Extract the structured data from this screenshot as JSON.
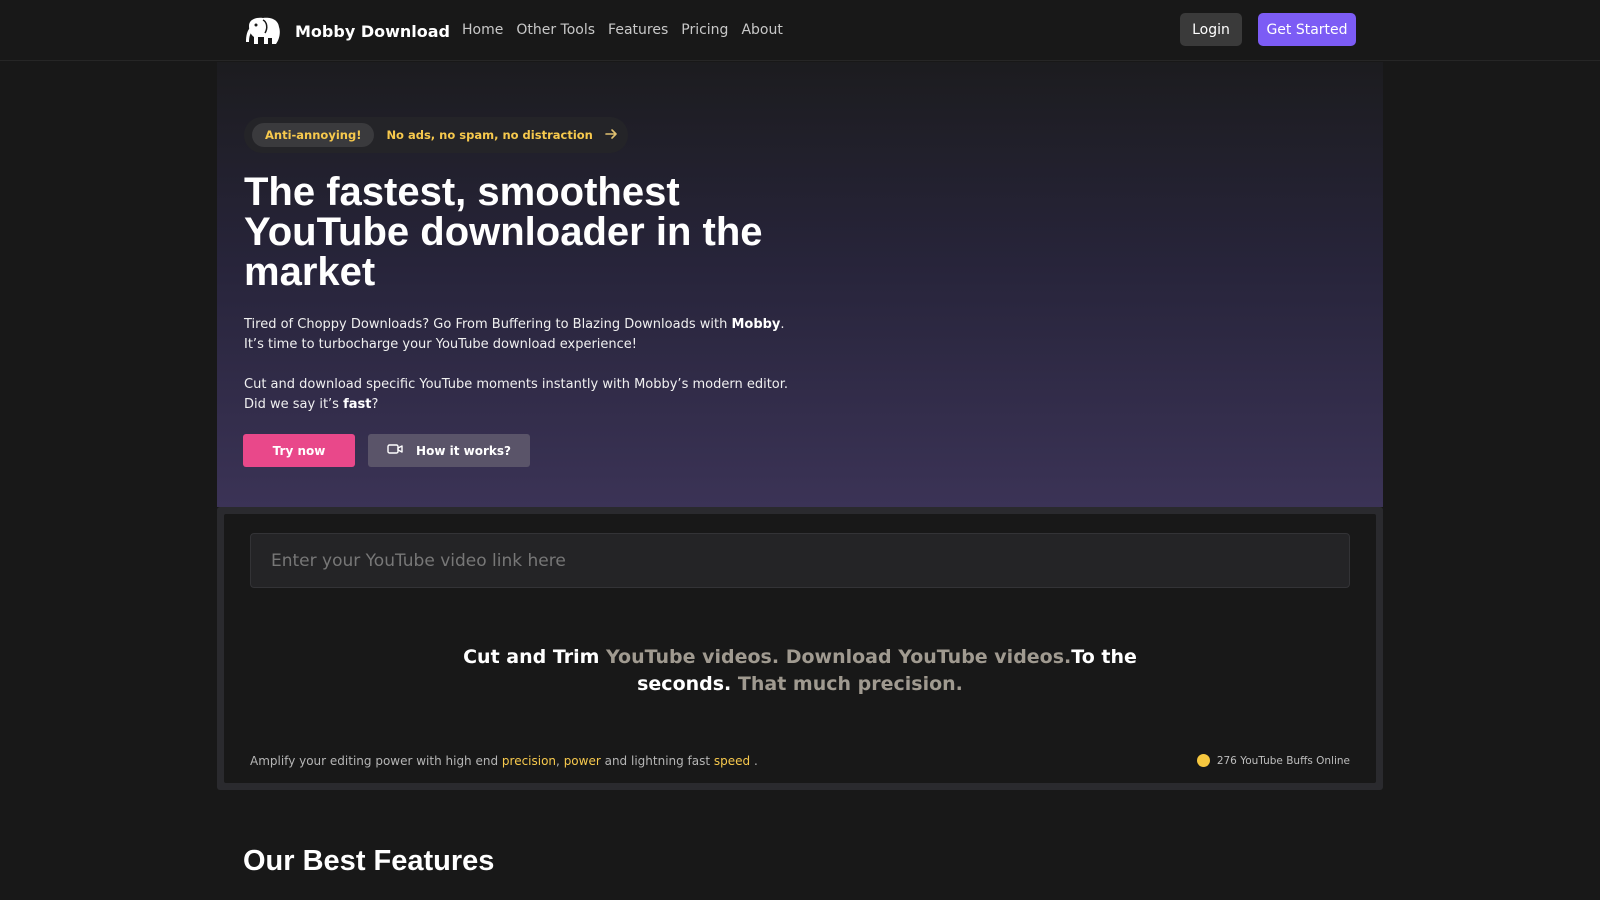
{
  "nav": {
    "brand": "Mobby Download",
    "links": [
      "Home",
      "Other Tools",
      "Features",
      "Pricing",
      "About"
    ],
    "login": "Login",
    "get_started": "Get Started"
  },
  "hero": {
    "pill_tag": "Anti-annoying!",
    "pill_text": "No ads, no spam, no distraction",
    "title": "The fastest, smoothest YouTube downloader in the market",
    "p1_a": "Tired of Choppy Downloads? Go From Buffering to Blazing Downloads with ",
    "p1_bold": "Mobby",
    "p1_b": ". It’s time to turbocharge your YouTube download experience!",
    "p2_a": "Cut and download specific YouTube moments instantly with Mobby’s modern editor. Did we say it’s ",
    "p2_bold": "fast",
    "p2_b": "?",
    "try_now": "Try now",
    "how_it_works": "How it works?"
  },
  "downloader": {
    "placeholder": "Enter your YouTube video link here",
    "tagline": {
      "part1": "Cut and Trim ",
      "part2": "YouTube videos. Download YouTube videos.",
      "part3": "To the seconds. ",
      "part4": "That much precision."
    },
    "footer": {
      "prefix": "Amplify your editing power with high end ",
      "word1": "precision",
      "sep": ", ",
      "word2": "power",
      "middle": " and lightning fast ",
      "word3": "speed",
      "suffix": " ."
    },
    "online": "276 YouTube Buffs Online"
  },
  "features": {
    "title": "Our Best Features"
  },
  "icons": {
    "brand": "elephant-icon",
    "pill": "arrow-right-icon",
    "how": "video-camera-icon",
    "status": "online-dot-icon"
  },
  "colors": {
    "accent_purple": "#7c5cf5",
    "accent_pink": "#e9488a",
    "highlight_yellow": "#f7c94d"
  }
}
